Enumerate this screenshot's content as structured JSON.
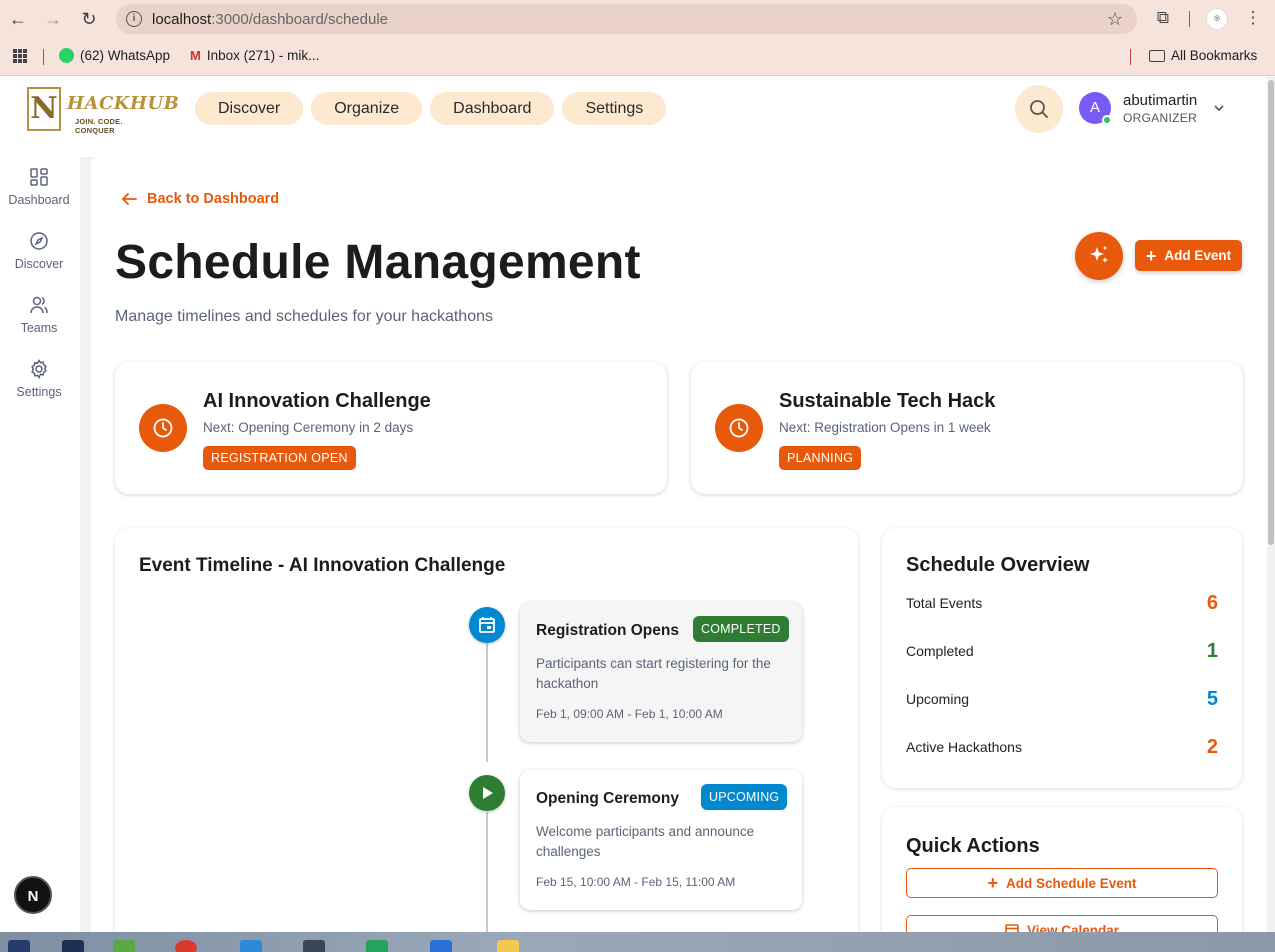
{
  "browser": {
    "url_host": "localhost",
    "url_path": ":3000/dashboard/schedule",
    "bookmarks": [
      {
        "label": "(62) WhatsApp"
      },
      {
        "label": "Inbox (271) - mik..."
      }
    ],
    "all_bookmarks": "All Bookmarks"
  },
  "app": {
    "logo_text": "HACKHUB",
    "logo_tagline": "JOIN. CODE. CONQUER",
    "nav": [
      "Discover",
      "Organize",
      "Dashboard",
      "Settings"
    ],
    "user": {
      "initial": "A",
      "name": "abutimartin",
      "role": "ORGANIZER"
    }
  },
  "sidebar": {
    "items": [
      {
        "label": "Dashboard",
        "icon": "grid-icon"
      },
      {
        "label": "Discover",
        "icon": "compass-icon"
      },
      {
        "label": "Teams",
        "icon": "users-icon"
      },
      {
        "label": "Settings",
        "icon": "gear-icon"
      }
    ]
  },
  "page": {
    "back_label": "Back to Dashboard",
    "title": "Schedule Management",
    "subtitle": "Manage timelines and schedules for your hackathons",
    "add_event_label": "Add Event"
  },
  "hackathons": [
    {
      "name": "AI Innovation Challenge",
      "next": "Next: Opening Ceremony in 2 days",
      "status": "REGISTRATION OPEN"
    },
    {
      "name": "Sustainable Tech Hack",
      "next": "Next: Registration Opens in 1 week",
      "status": "PLANNING"
    }
  ],
  "timeline": {
    "title": "Event Timeline - AI Innovation Challenge",
    "events": [
      {
        "title": "Registration Opens",
        "status": "COMPLETED",
        "description": "Participants can start registering for the hackathon",
        "time": "Feb 1, 09:00 AM - Feb 1, 10:00 AM",
        "icon": "calendar-icon"
      },
      {
        "title": "Opening Ceremony",
        "status": "UPCOMING",
        "description": "Welcome participants and announce challenges",
        "time": "Feb 15, 10:00 AM - Feb 15, 11:00 AM",
        "icon": "play-icon"
      }
    ]
  },
  "overview": {
    "title": "Schedule Overview",
    "rows": [
      {
        "label": "Total Events",
        "value": "6",
        "color": "#e8590c"
      },
      {
        "label": "Completed",
        "value": "1",
        "color": "#2e7d32"
      },
      {
        "label": "Upcoming",
        "value": "5",
        "color": "#0288d1"
      },
      {
        "label": "Active Hackathons",
        "value": "2",
        "color": "#e8590c"
      }
    ]
  },
  "quick_actions": {
    "title": "Quick Actions",
    "buttons": [
      "Add Schedule Event",
      "View Calendar"
    ]
  },
  "colors": {
    "accent": "#e8590c",
    "completed": "#2e7d32",
    "upcoming": "#0288d1"
  },
  "dev_badge": "N"
}
